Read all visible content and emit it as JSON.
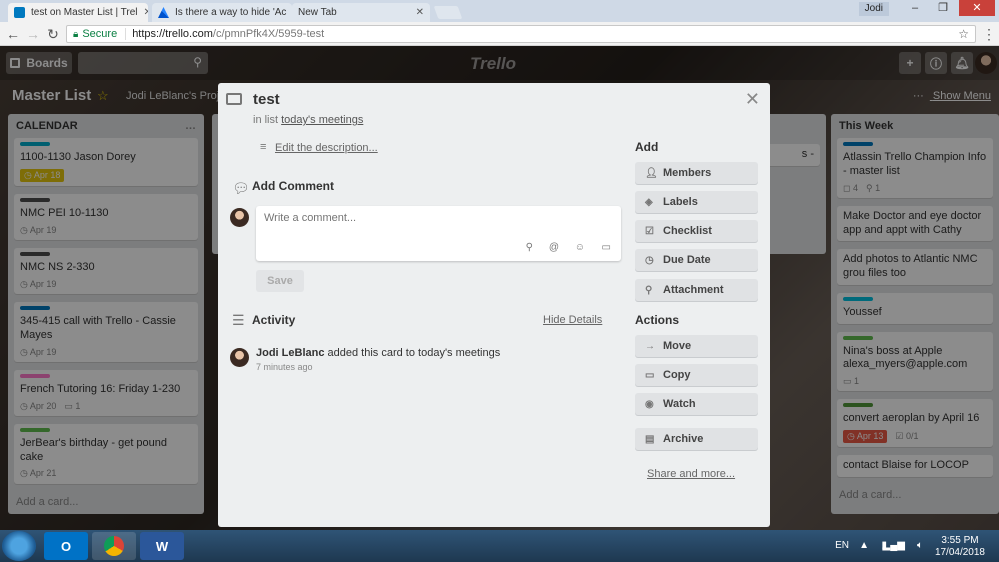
{
  "browser": {
    "tabs": [
      {
        "title": "test on Master List | Trel",
        "active": true
      },
      {
        "title": "Is there a way to hide 'Ac",
        "active": false
      },
      {
        "title": "New Tab",
        "active": false
      }
    ],
    "user": "Jodi",
    "secure_label": "Secure",
    "url_host": "https://trello.com",
    "url_path": "/c/pmnPfk4X/5959-test"
  },
  "header": {
    "boards_label": "Boards",
    "logo": "Trello"
  },
  "board": {
    "title": "Master List",
    "team": "Jodi LeBlanc's Proje",
    "show_menu": "Show Menu"
  },
  "lists": {
    "calendar": {
      "title": "CALENDAR",
      "cards": [
        {
          "title": "1100-1130 Jason Dorey",
          "label_color": "#00aecc",
          "due": "Apr 18",
          "due_style": "yellow"
        },
        {
          "title": "NMC PEI 10-1130",
          "label_color": "#4d4d4d",
          "due": "Apr 19",
          "due_style": "plain"
        },
        {
          "title": "NMC NS 2-330",
          "label_color": "#4d4d4d",
          "due": "Apr 19",
          "due_style": "plain"
        },
        {
          "title": "345-415 call with Trello - Cassie Mayes",
          "label_color": "#0079bf",
          "due": "Apr 19",
          "due_style": "plain"
        },
        {
          "title": "French Tutoring 16: Friday 1-230",
          "label_color": "#ff78cb",
          "due": "Apr 20",
          "due_style": "plain",
          "comments": "1"
        },
        {
          "title": "JerBear's birthday - get pound cake",
          "label_color": "#61bd4f",
          "due": "Apr 21",
          "due_style": "plain"
        }
      ],
      "add_card": "Add a card..."
    },
    "this_week": {
      "title": "This Week",
      "cards": [
        {
          "title": "Atlassin Trello Champion Info - master list",
          "label_color": "#0079bf",
          "subs": "4",
          "attach": "1"
        },
        {
          "title": "Make Doctor and eye doctor app and appt with Cathy"
        },
        {
          "title": "Add photos to Atlantic NMC grou files too"
        },
        {
          "title": "Youssef",
          "label_color": "#00c2e0"
        },
        {
          "title": "Nina's boss at Apple alexa_myers@apple.com",
          "label_color": "#61bd4f",
          "comments": "1"
        },
        {
          "title": "convert aeroplan by April 16",
          "label_color": "#519839",
          "due": "Apr 13",
          "checklist": "0/1"
        },
        {
          "title": "contact Blaise for LOCOP"
        }
      ],
      "add_card": "Add a card..."
    },
    "partial": {
      "snippet_1": "s -",
      "snippet_2": ""
    }
  },
  "modal": {
    "title": "test",
    "in_list_prefix": "in list",
    "list_name": "today's meetings",
    "edit_description": "Edit the description...",
    "add_comment_heading": "Add Comment",
    "comment_placeholder": "Write a comment...",
    "save_label": "Save",
    "activity_heading": "Activity",
    "hide_details": "Hide Details",
    "activity": {
      "user": "Jodi LeBlanc",
      "action": "added this card to today's meetings",
      "time": "7 minutes ago"
    },
    "add_heading": "Add",
    "add_buttons": [
      "Members",
      "Labels",
      "Checklist",
      "Due Date",
      "Attachment"
    ],
    "actions_heading": "Actions",
    "action_buttons": [
      "Move",
      "Copy",
      "Watch",
      "Archive"
    ],
    "share_more": "Share and more..."
  },
  "taskbar": {
    "lang": "EN",
    "time": "3:55 PM",
    "date": "17/04/2018"
  },
  "colors": {
    "trello_yellow": "#f2d600",
    "secure_green": "#0b8043"
  }
}
